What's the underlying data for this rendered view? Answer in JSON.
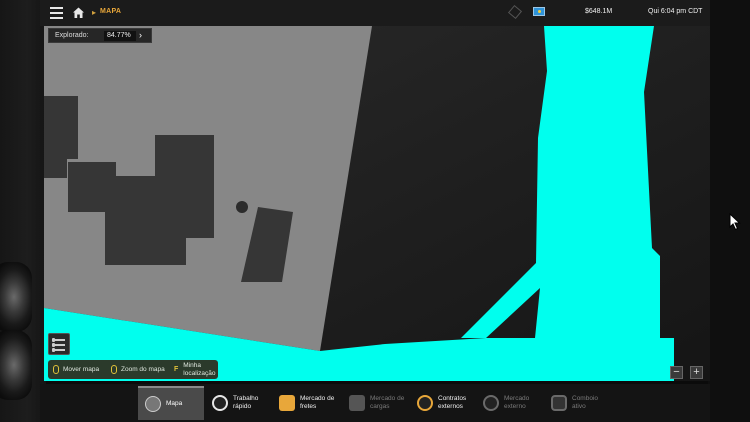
{
  "topbar": {
    "breadcrumb": "MAPA",
    "money": "$648.1M",
    "clock": "Qui 6:04 pm CDT"
  },
  "explored": {
    "label": "Explorado:",
    "value": "84.77%"
  },
  "hints": [
    {
      "label": "Mover mapa",
      "key": "mouse-left"
    },
    {
      "label": "Zoom do mapa",
      "key": "mouse-wheel"
    },
    {
      "label": "Minha\nlocalização",
      "key": "F"
    }
  ],
  "zoom": {
    "out": "−",
    "in": "+"
  },
  "tabs": [
    {
      "label": "Mapa",
      "active": true,
      "enabled": true,
      "icon": "map-icon"
    },
    {
      "label": "Trabalho\nrápido",
      "active": false,
      "enabled": true,
      "icon": "quick-job-icon"
    },
    {
      "label": "Mercado de\nfretes",
      "active": false,
      "enabled": true,
      "icon": "freight-market-icon"
    },
    {
      "label": "Mercado de\ncargas",
      "active": false,
      "enabled": false,
      "icon": "cargo-market-icon"
    },
    {
      "label": "Contratos\nexternos",
      "active": false,
      "enabled": true,
      "icon": "external-contracts-icon"
    },
    {
      "label": "Mercado\nexterno",
      "active": false,
      "enabled": false,
      "icon": "external-market-icon"
    },
    {
      "label": "Comboio\nativo",
      "active": false,
      "enabled": false,
      "icon": "convoy-icon"
    }
  ],
  "colors": {
    "road": "#00ffee",
    "area": "#878787",
    "accent": "#e8a73a"
  }
}
